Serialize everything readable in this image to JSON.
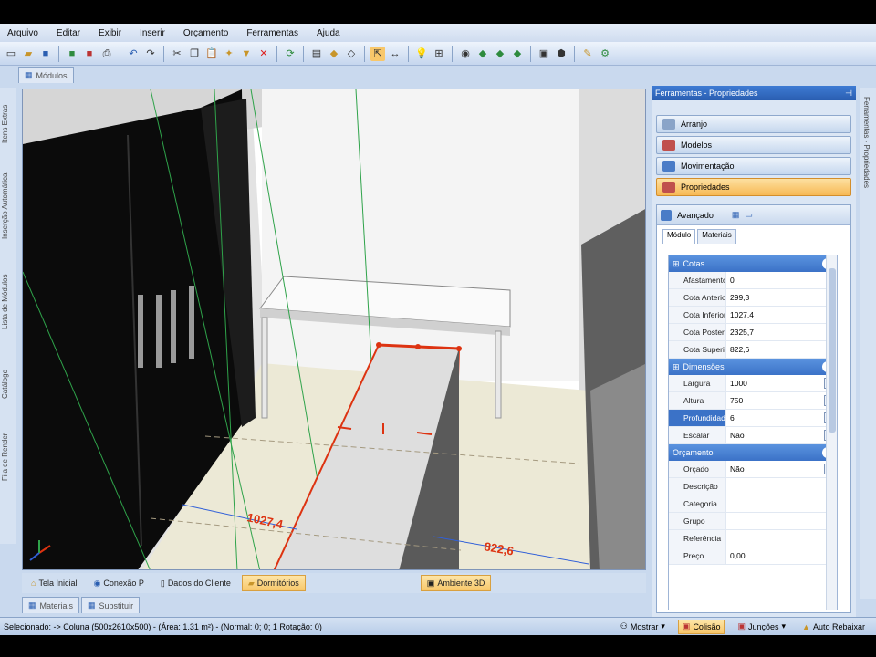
{
  "menu": [
    "Arquivo",
    "Editar",
    "Exibir",
    "Inserir",
    "Orçamento",
    "Ferramentas",
    "Ajuda"
  ],
  "doc_tab": "Módulos",
  "left_tabs": [
    "Itens Extras",
    "Inserção Automática",
    "Lista de Módulos",
    "Catálogo",
    "Fila de Render"
  ],
  "right_tab": "Ferramentas - Propriedades",
  "viewport": {
    "dim_left": "1027,4",
    "dim_right": "822,6"
  },
  "bottom_tabs": [
    "Tela Inicial",
    "Conexão P",
    "Dados do Cliente",
    "Dormitórios",
    "Ambiente 3D"
  ],
  "lower_tabs": [
    "Materiais",
    "Substituir"
  ],
  "status": {
    "text": "Selecionado: -> Coluna (500x2610x500) - (Área: 1.31 m²) - (Normal: 0; 0; 1 Rotação: 0)",
    "mostrar": "Mostrar",
    "colisao": "Colisão",
    "juncoes": "Junções",
    "auto": "Auto Rebaixar"
  },
  "panel": {
    "title": "Ferramentas - Propriedades",
    "nav": [
      "Arranjo",
      "Modelos",
      "Movimentação",
      "Propriedades"
    ],
    "advanced": "Avançado",
    "subtabs": [
      "Módulo",
      "Materiais"
    ],
    "cotas_title": "Cotas",
    "cotas": [
      {
        "k": "Afastamento",
        "v": "0"
      },
      {
        "k": "Cota Anterior",
        "v": "299,3"
      },
      {
        "k": "Cota Inferior",
        "v": "1027,4"
      },
      {
        "k": "Cota Posterior",
        "v": "2325,7"
      },
      {
        "k": "Cota Superior",
        "v": "822,6"
      }
    ],
    "dim_title": "Dimensões",
    "dims": [
      {
        "k": "Largura",
        "v": "1000"
      },
      {
        "k": "Altura",
        "v": "750"
      },
      {
        "k": "Profundidade",
        "v": "6"
      },
      {
        "k": "Escalar",
        "v": "Não"
      }
    ],
    "orc_title": "Orçamento",
    "orc": [
      {
        "k": "Orçado",
        "v": "Não"
      },
      {
        "k": "Descrição",
        "v": ""
      },
      {
        "k": "Categoria",
        "v": ""
      },
      {
        "k": "Grupo",
        "v": ""
      },
      {
        "k": "Referência",
        "v": ""
      },
      {
        "k": "Preço",
        "v": "0,00"
      }
    ]
  }
}
